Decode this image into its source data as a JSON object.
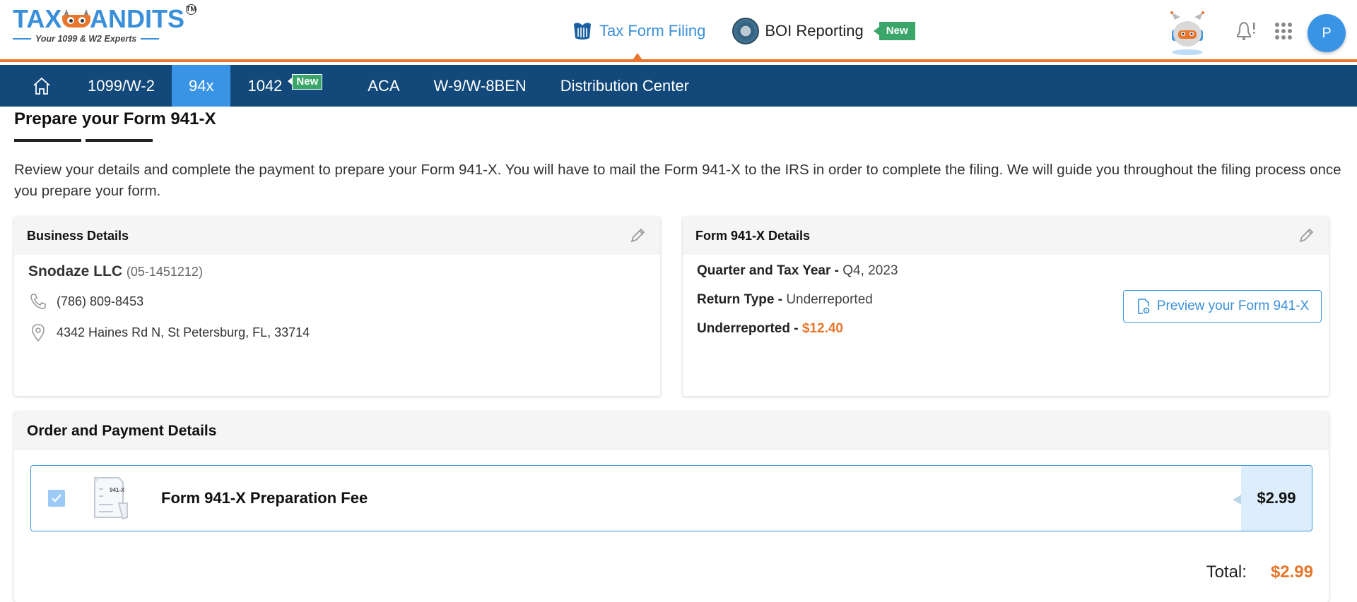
{
  "header": {
    "logo": {
      "part1": "TAX",
      "part2": "ANDITS",
      "tm": "TM",
      "tagline": "Your 1099 & W2 Experts"
    },
    "top_nav": [
      {
        "label": "Tax Form Filing",
        "icon": "irs-eagle-icon",
        "active": true
      },
      {
        "label": "BOI Reporting",
        "icon": "boi-seal-icon",
        "badge": "New",
        "active": false
      }
    ],
    "avatar_initial": "P",
    "accent_color": "#e8762d",
    "brand_color": "#3a8fd9"
  },
  "main_nav": {
    "items": [
      {
        "label": "1099/W-2"
      },
      {
        "label": "94x",
        "active": true
      },
      {
        "label": "1042",
        "badge": "New"
      },
      {
        "label": "ACA"
      },
      {
        "label": "W-9/W-8BEN"
      },
      {
        "label": "Distribution Center"
      }
    ],
    "bg_color": "#12487a",
    "active_color": "#3a94e6"
  },
  "page": {
    "title": "Prepare your Form 941-X",
    "intro": "Review your details and complete the payment to prepare your Form 941-X. You will have to mail the Form 941-X to the IRS in order to complete the filing. We will guide you throughout the filing process once you prepare your form."
  },
  "business": {
    "heading": "Business Details",
    "name": "Snodaze LLC",
    "ein": "(05-1451212)",
    "phone": "(786) 809-8453",
    "address": "4342 Haines Rd N, St Petersburg, FL, 33714"
  },
  "form_details": {
    "heading": "Form 941-X Details",
    "quarter_label": "Quarter and Tax Year - ",
    "quarter_value": "Q4, 2023",
    "return_type_label": "Return Type - ",
    "return_type_value": "Underreported",
    "amount_label": "Underreported - ",
    "amount_value": "$12.40",
    "preview_button": "Preview your Form 941-X"
  },
  "order": {
    "heading": "Order and Payment Details",
    "item": {
      "label": "Form 941-X Preparation Fee",
      "doc_label": "941-X",
      "price": "$2.99",
      "checked": true
    },
    "total_label": "Total:",
    "total_value": "$2.99"
  }
}
